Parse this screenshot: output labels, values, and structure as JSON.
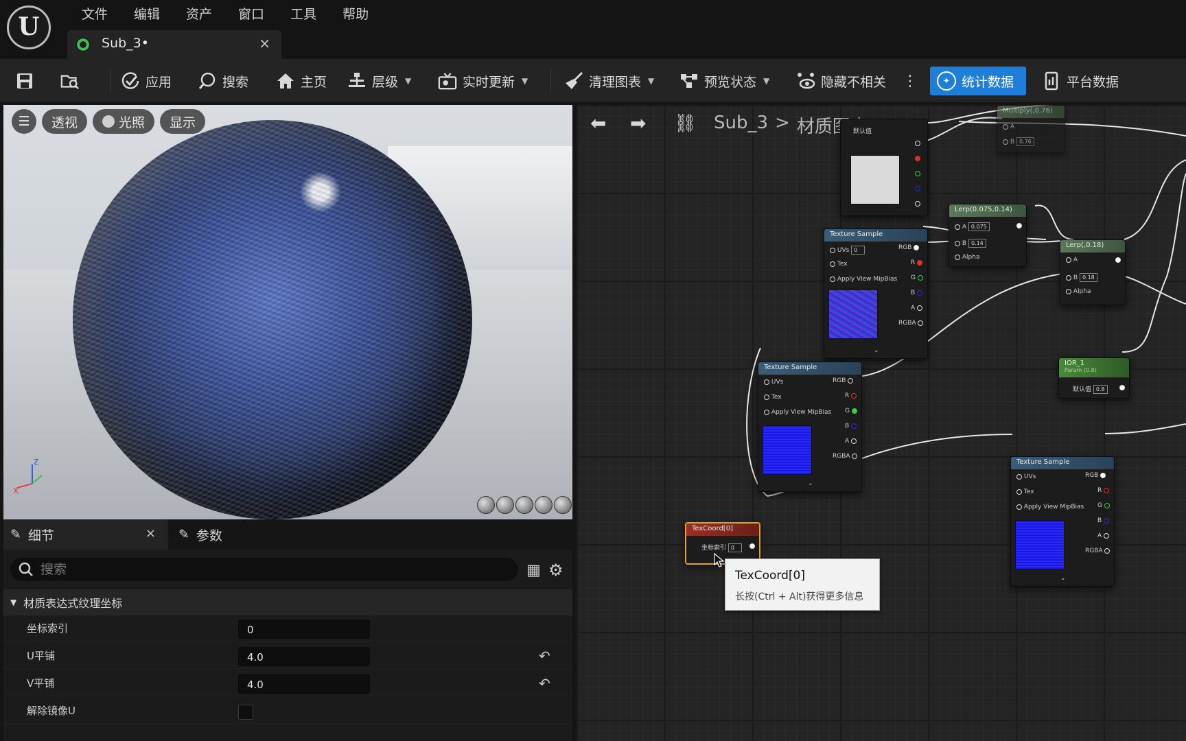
{
  "menu": [
    "文件",
    "编辑",
    "资产",
    "窗口",
    "工具",
    "帮助"
  ],
  "doc_tab": {
    "label": "Sub_3•",
    "close": "×"
  },
  "toolbar": {
    "apply": "应用",
    "search": "搜索",
    "home": "主页",
    "hierarchy": "层级",
    "live_update": "实时更新",
    "clean_graph": "清理图表",
    "preview_state": "预览状态",
    "hide_unrelated": "隐藏不相关",
    "stats": "统计数据",
    "platform_stats": "平台数据"
  },
  "viewport": {
    "perspective": "透视",
    "lit": "光照",
    "show": "显示"
  },
  "details": {
    "tab_details": "细节",
    "tab_params": "参数",
    "search_placeholder": "搜索",
    "section": "材质表达式纹理坐标",
    "rows": [
      {
        "label": "坐标索引",
        "value": "0"
      },
      {
        "label": "U平铺",
        "value": "4.0"
      },
      {
        "label": "V平铺",
        "value": "4.0"
      },
      {
        "label": "解除镜像U"
      }
    ]
  },
  "graph": {
    "breadcrumb_root": "Sub_3",
    "breadcrumb_sep": ">",
    "breadcrumb_current": "材质图表",
    "nodes": {
      "multiply": {
        "title": "Multiply(,0.76)",
        "a": "A",
        "b": "B",
        "b_val": "0.76"
      },
      "param_top": {
        "label": "默认值"
      },
      "ts1": {
        "title": "Texture Sample",
        "uvs": "UVs",
        "uvs_val": "0",
        "tex": "Tex",
        "mip": "Apply View MipBias",
        "rgb": "RGB",
        "r": "R",
        "g": "G",
        "b": "B",
        "a": "A",
        "rgba": "RGBA"
      },
      "lerp1": {
        "title": "Lerp(0.075,0.14)",
        "a": "A",
        "a_val": "0.075",
        "b": "B",
        "b_val": "0.14",
        "alpha": "Alpha"
      },
      "lerp2": {
        "title": "Lerp(,0.18)",
        "a": "A",
        "b": "B",
        "b_val": "0.18",
        "alpha": "Alpha"
      },
      "ts2": {
        "title": "Texture Sample",
        "uvs": "UVs",
        "tex": "Tex",
        "mip": "Apply View MipBias",
        "rgb": "RGB",
        "r": "R",
        "g": "G",
        "b": "B",
        "a": "A",
        "rgba": "RGBA"
      },
      "ior": {
        "title": "IOR_1",
        "sub": "Param (0.8)",
        "label": "默认值",
        "val": "0.8"
      },
      "ts3": {
        "title": "Texture Sample",
        "uvs": "UVs",
        "tex": "Tex",
        "mip": "Apply View MipBias",
        "rgb": "RGB",
        "r": "R",
        "g": "G",
        "b": "B",
        "a": "A",
        "rgba": "RGBA"
      },
      "texcoord": {
        "title": "TexCoord[0]",
        "label": "坐标索引",
        "val": "0"
      }
    },
    "tooltip": {
      "title": "TexCoord[0]",
      "desc": "长按(Ctrl + Alt)获得更多信息"
    }
  },
  "colors": {
    "accent": "#1f7fd8",
    "panel": "#242424",
    "background": "#151515"
  }
}
